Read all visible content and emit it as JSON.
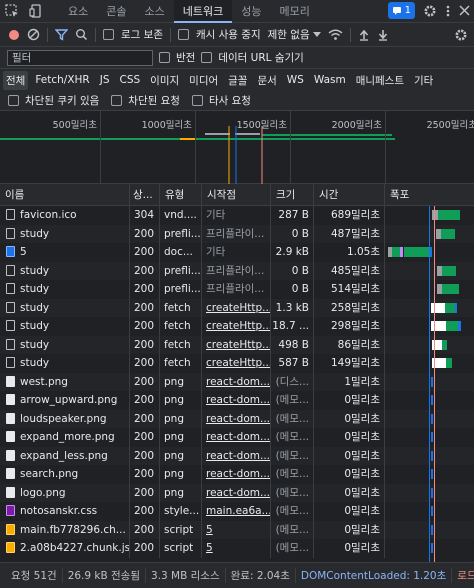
{
  "tabs": [
    {
      "label": "요소",
      "active": false
    },
    {
      "label": "콘솔",
      "active": false
    },
    {
      "label": "소스",
      "active": false
    },
    {
      "label": "네트워크",
      "active": true
    },
    {
      "label": "성능",
      "active": false
    },
    {
      "label": "메모리",
      "active": false
    }
  ],
  "message_count": "1",
  "toolbar": {
    "preserve_log": "로그 보존",
    "disable_cache": "캐시 사용 중지",
    "throttle": "제한 없음"
  },
  "filter": {
    "placeholder": "필터",
    "invert": "반전",
    "hide_data_urls": "데이터 URL 숨기기"
  },
  "type_filters": [
    {
      "label": "전체",
      "active": true
    },
    {
      "label": "Fetch/XHR",
      "active": false
    },
    {
      "label": "JS",
      "active": false
    },
    {
      "label": "CSS",
      "active": false
    },
    {
      "label": "이미지",
      "active": false
    },
    {
      "label": "미디어",
      "active": false
    },
    {
      "label": "글꼴",
      "active": false
    },
    {
      "label": "문서",
      "active": false
    },
    {
      "label": "WS",
      "active": false
    },
    {
      "label": "Wasm",
      "active": false
    },
    {
      "label": "매니페스트",
      "active": false
    },
    {
      "label": "기타",
      "active": false
    }
  ],
  "block_filters": {
    "blocked_cookies": "차단된 쿠키 있음",
    "blocked_requests": "차단된 요청",
    "third_party": "타사 요청"
  },
  "overview": {
    "ticks": [
      {
        "label": "500밀리초",
        "ms": 500
      },
      {
        "label": "1000밀리초",
        "ms": 1000
      },
      {
        "label": "1500밀리초",
        "ms": 1500
      },
      {
        "label": "2000밀리초",
        "ms": 2000
      },
      {
        "label": "2500밀리초",
        "ms": 2500
      }
    ]
  },
  "columns": {
    "name": "이름",
    "status": "상...",
    "type": "유형",
    "initiator": "시작점",
    "size": "크기",
    "time": "시간",
    "waterfall": "폭포"
  },
  "rows": [
    {
      "name": "favicon.ico",
      "icon": "file",
      "status": "304",
      "type": "vnd....",
      "initiator": "기타",
      "initiator_link": false,
      "size": "287 B",
      "time": "689밀리초"
    },
    {
      "name": "study",
      "icon": "file",
      "status": "200",
      "type": "prefli...",
      "initiator": "프리플라이...",
      "initiator_link": false,
      "size": "0 B",
      "time": "487밀리초"
    },
    {
      "name": "5",
      "icon": "doc",
      "status": "200",
      "type": "doc...",
      "initiator": "기타",
      "initiator_link": false,
      "size": "2.9 kB",
      "time": "1.05초"
    },
    {
      "name": "study",
      "icon": "file",
      "status": "200",
      "type": "prefli...",
      "initiator": "프리플라이...",
      "initiator_link": false,
      "size": "0 B",
      "time": "485밀리초"
    },
    {
      "name": "study",
      "icon": "file",
      "status": "200",
      "type": "prefli...",
      "initiator": "프리플라이...",
      "initiator_link": false,
      "size": "0 B",
      "time": "514밀리초"
    },
    {
      "name": "study",
      "icon": "file",
      "status": "200",
      "type": "fetch",
      "initiator": "createHttp...",
      "initiator_link": true,
      "size": "1.3 kB",
      "time": "258밀리초"
    },
    {
      "name": "study",
      "icon": "file",
      "status": "200",
      "type": "fetch",
      "initiator": "createHttp...",
      "initiator_link": true,
      "size": "18.7 ...",
      "time": "298밀리초"
    },
    {
      "name": "study",
      "icon": "file",
      "status": "200",
      "type": "fetch",
      "initiator": "createHttp...",
      "initiator_link": true,
      "size": "498 B",
      "time": "86밀리초"
    },
    {
      "name": "study",
      "icon": "file",
      "status": "200",
      "type": "fetch",
      "initiator": "createHttp...",
      "initiator_link": true,
      "size": "587 B",
      "time": "149밀리초"
    },
    {
      "name": "west.png",
      "icon": "img",
      "status": "200",
      "type": "png",
      "initiator": "react-dom...",
      "initiator_link": true,
      "size": "(디스...",
      "time": "1밀리초"
    },
    {
      "name": "arrow_upward.png",
      "icon": "img",
      "status": "200",
      "type": "png",
      "initiator": "react-dom...",
      "initiator_link": true,
      "size": "(메모...",
      "time": "0밀리초"
    },
    {
      "name": "loudspeaker.png",
      "icon": "img",
      "status": "200",
      "type": "png",
      "initiator": "react-dom...",
      "initiator_link": true,
      "size": "(메모...",
      "time": "0밀리초"
    },
    {
      "name": "expand_more.png",
      "icon": "img",
      "status": "200",
      "type": "png",
      "initiator": "react-dom...",
      "initiator_link": true,
      "size": "(메모...",
      "time": "0밀리초"
    },
    {
      "name": "expand_less.png",
      "icon": "img",
      "status": "200",
      "type": "png",
      "initiator": "react-dom...",
      "initiator_link": true,
      "size": "(메모...",
      "time": "0밀리초"
    },
    {
      "name": "search.png",
      "icon": "img",
      "status": "200",
      "type": "png",
      "initiator": "react-dom...",
      "initiator_link": true,
      "size": "(메모...",
      "time": "0밀리초"
    },
    {
      "name": "logo.png",
      "icon": "img",
      "status": "200",
      "type": "png",
      "initiator": "react-dom...",
      "initiator_link": true,
      "size": "(메모...",
      "time": "0밀리초"
    },
    {
      "name": "notosanskr.css",
      "icon": "css",
      "status": "200",
      "type": "style...",
      "initiator": "main.ea6a...",
      "initiator_link": true,
      "size": "(메모...",
      "time": "0밀리초"
    },
    {
      "name": "main.fb778296.ch...",
      "icon": "js",
      "status": "200",
      "type": "script",
      "initiator": "5",
      "initiator_link": true,
      "size": "(메모...",
      "time": "0밀리초"
    },
    {
      "name": "2.a08b4227.chunk.js",
      "icon": "js",
      "status": "200",
      "type": "script",
      "initiator": "5",
      "initiator_link": true,
      "size": "(메모...",
      "time": "0밀리초"
    }
  ],
  "status": {
    "requests": "요청 51건",
    "transferred": "26.9 kB 전송됨",
    "resources": "3.3 MB 리소스",
    "finish": "완료: 2.04초",
    "dcl": "DOMContentLoaded: 1.20초",
    "load": "로드"
  },
  "colors": {
    "accent": "#8ab4f8",
    "waiting": "#0f9d58",
    "download": "#1a73e8",
    "dcl_line": "#1a73e8",
    "load_line": "#f28b82"
  }
}
